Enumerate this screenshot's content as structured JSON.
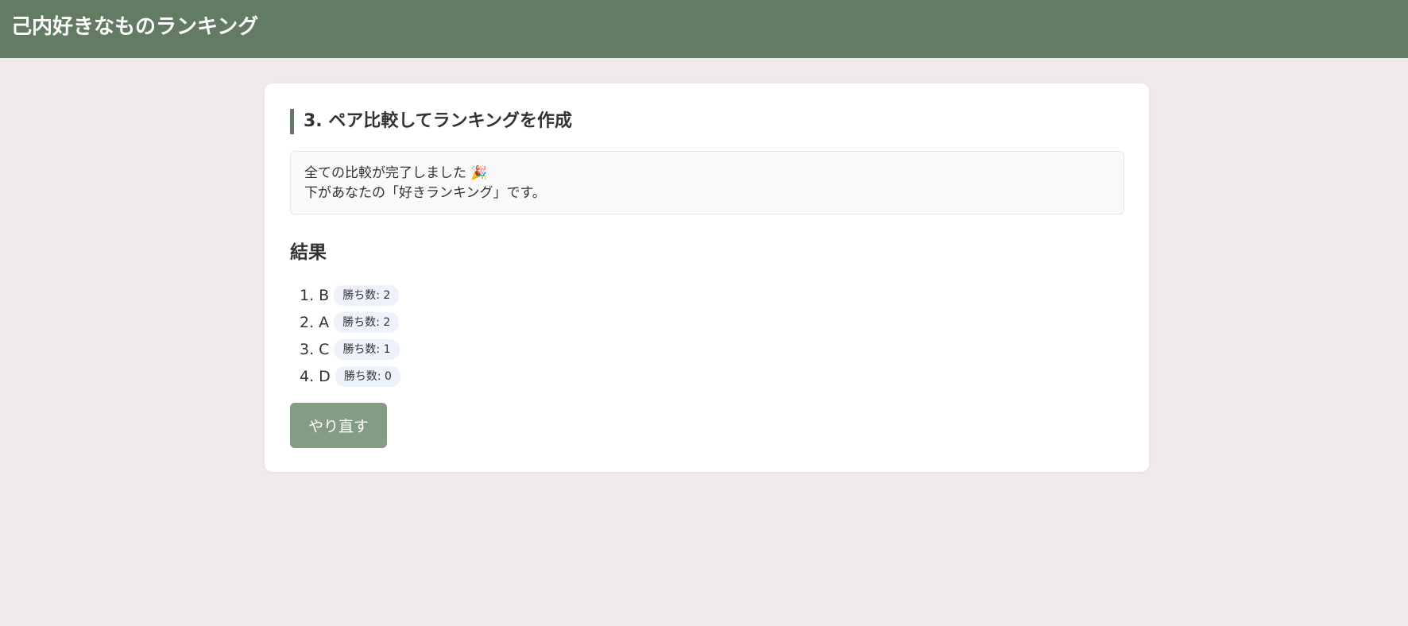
{
  "header": {
    "title": "己内好きなものランキング"
  },
  "step": {
    "heading": "3. ペア比較してランキングを作成"
  },
  "message": {
    "line1": "全ての比較が完了しました 🎉",
    "line2": "下があなたの「好きランキング」です。"
  },
  "results": {
    "heading": "結果",
    "items": [
      {
        "label": "1. B",
        "wins": "勝ち数: 2"
      },
      {
        "label": "2. A",
        "wins": "勝ち数: 2"
      },
      {
        "label": "3. C",
        "wins": "勝ち数: 1"
      },
      {
        "label": "4. D",
        "wins": "勝ち数: 0"
      }
    ]
  },
  "actions": {
    "retry_label": "やり直す"
  },
  "colors": {
    "header_bg": "#637a63",
    "page_bg": "#f0eaea",
    "button_bg": "#849c84",
    "badge_bg": "#eef2fb"
  }
}
